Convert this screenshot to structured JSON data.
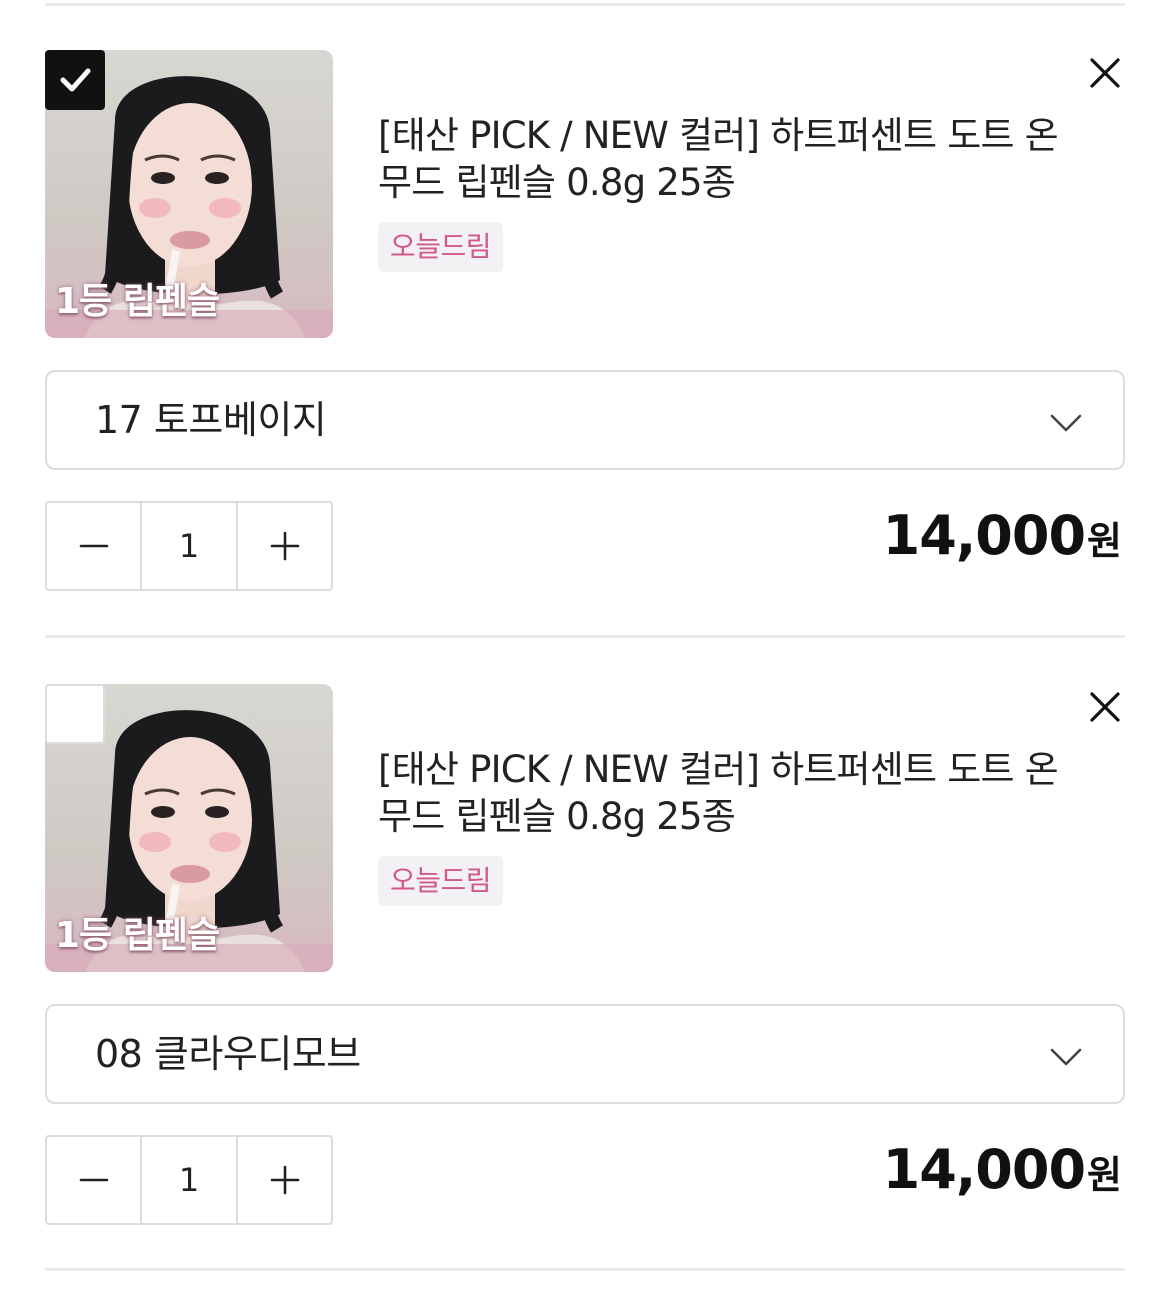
{
  "cart": {
    "items": [
      {
        "checked": true,
        "title": "[태산 PICK / NEW 컬러] 하트퍼센트 도트 온 무드 립펜슬 0.8g 25종",
        "badge": "오늘드림",
        "image_caption": "1등 립펜슬",
        "option": "17 토프베이지",
        "quantity": "1",
        "price": "14,000",
        "currency": "원"
      },
      {
        "checked": false,
        "title": "[태산 PICK / NEW 컬러] 하트퍼센트 도트 온 무드 립펜슬 0.8g 25종",
        "badge": "오늘드림",
        "image_caption": "1등 립펜슬",
        "option": "08 클라우디모브",
        "quantity": "1",
        "price": "14,000",
        "currency": "원"
      }
    ]
  },
  "colors": {
    "badge_text": "#d1588a",
    "badge_bg": "#f3f1f4",
    "checkbox_checked": "#111111",
    "border": "#dcdcdc",
    "divider": "#ebebeb"
  }
}
